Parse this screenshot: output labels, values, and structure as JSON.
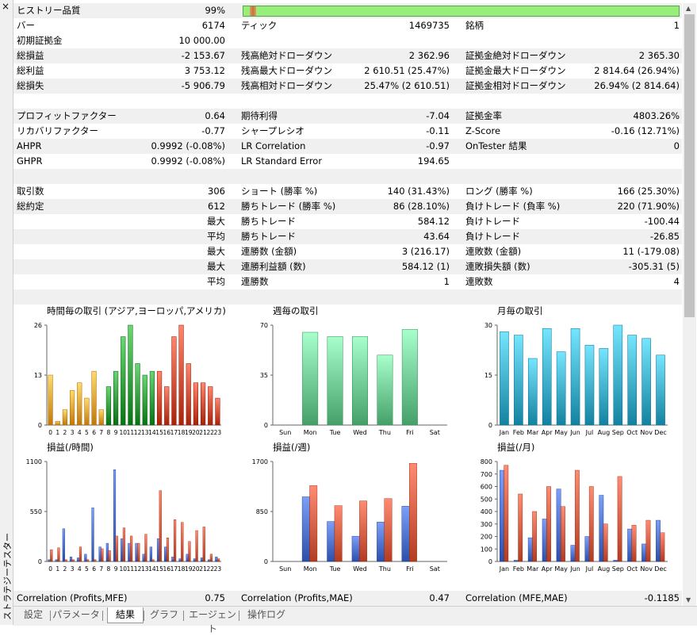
{
  "window": {
    "vertical_title": "ストラテジーテスター",
    "close_glyph": "×"
  },
  "quality": {
    "label": "ヒストリー品質",
    "value": "99%",
    "fraction": 0.99
  },
  "rows": [
    {
      "l1": "バー",
      "v1": "6174",
      "l2": "ティック",
      "v2": "1469735",
      "l3": "銘柄",
      "v3": "1",
      "shade": false
    },
    {
      "l1": "初期証拠金",
      "v1": "10 000.00",
      "l2": "",
      "v2": "",
      "l3": "",
      "v3": "",
      "shade": false
    },
    {
      "l1": "総損益",
      "v1": "-2 153.67",
      "l2": "残高絶対ドローダウン",
      "v2": "2 362.96",
      "l3": "証拠金絶対ドローダウン",
      "v3": "2 365.30",
      "shade": true
    },
    {
      "l1": "総利益",
      "v1": "3 753.12",
      "l2": "残高最大ドローダウン",
      "v2": "2 610.51 (25.47%)",
      "l3": "証拠金最大ドローダウン",
      "v3": "2 814.64 (26.94%)",
      "shade": false
    },
    {
      "l1": "総損失",
      "v1": "-5 906.79",
      "l2": "残高相対ドローダウン",
      "v2": "25.47% (2 610.51)",
      "l3": "証拠金相対ドローダウン",
      "v3": "26.94% (2 814.64)",
      "shade": true
    },
    {
      "l1": "",
      "v1": "",
      "l2": "",
      "v2": "",
      "l3": "",
      "v3": "",
      "shade": false
    },
    {
      "l1": "プロフィットファクター",
      "v1": "0.64",
      "l2": "期待利得",
      "v2": "-7.04",
      "l3": "証拠金率",
      "v3": "4803.26%",
      "shade": true
    },
    {
      "l1": "リカバリファクター",
      "v1": "-0.77",
      "l2": "シャープレシオ",
      "v2": "-0.11",
      "l3": "Z-Score",
      "v3": "-0.16 (12.71%)",
      "shade": false
    },
    {
      "l1": "AHPR",
      "v1": "0.9992 (-0.08%)",
      "l2": "LR Correlation",
      "v2": "-0.97",
      "l3": "OnTester 結果",
      "v3": "0",
      "shade": true
    },
    {
      "l1": "GHPR",
      "v1": "0.9992 (-0.08%)",
      "l2": "LR Standard Error",
      "v2": "194.65",
      "l3": "",
      "v3": "",
      "shade": false
    },
    {
      "l1": "",
      "v1": "",
      "l2": "",
      "v2": "",
      "l3": "",
      "v3": "",
      "shade": true
    },
    {
      "l1": "取引数",
      "v1": "306",
      "l2": "ショート (勝率 %)",
      "v2": "140 (31.43%)",
      "l3": "ロング (勝率 %)",
      "v3": "166 (25.30%)",
      "shade": false
    },
    {
      "l1": "総約定",
      "v1": "612",
      "l2": "勝ちトレード (勝率 %)",
      "v2": "86 (28.10%)",
      "l3": "負けトレード (負率 %)",
      "v3": "220 (71.90%)",
      "shade": true
    },
    {
      "l1": "",
      "v1": "最大",
      "l2": "勝ちトレード",
      "v2": "584.12",
      "l3": "負けトレード",
      "v3": "-100.44",
      "shade": false
    },
    {
      "l1": "",
      "v1": "平均",
      "l2": "勝ちトレード",
      "v2": "43.64",
      "l3": "負けトレード",
      "v3": "-26.85",
      "shade": true
    },
    {
      "l1": "",
      "v1": "最大",
      "l2": "連勝数 (金額)",
      "v2": "3 (216.17)",
      "l3": "連敗数 (金額)",
      "v3": "11 (-179.08)",
      "shade": false
    },
    {
      "l1": "",
      "v1": "最大",
      "l2": "連勝利益額 (数)",
      "v2": "584.12 (1)",
      "l3": "連敗損失額 (数)",
      "v3": "-305.31 (5)",
      "shade": true
    },
    {
      "l1": "",
      "v1": "平均",
      "l2": "連勝数",
      "v2": "1",
      "l3": "連敗数",
      "v3": "4",
      "shade": false
    },
    {
      "l1": "",
      "v1": "",
      "l2": "",
      "v2": "",
      "l3": "",
      "v3": "",
      "shade": true
    }
  ],
  "correlation_row": {
    "l1": "Correlation (Profits,MFE)",
    "v1": "0.75",
    "l2": "Correlation (Profits,MAE)",
    "v2": "0.47",
    "l3": "Correlation (MFE,MAE)",
    "v3": "-0.1185"
  },
  "tabs": [
    "設定",
    "パラメータ",
    "結果",
    "グラフ",
    "エージェント",
    "操作ログ"
  ],
  "active_tab": 2,
  "colors": {
    "asia": "#e8a030",
    "europe": "#2e9a3a",
    "america": "#d04a30",
    "week": "#6cc890",
    "month": "#3aaac8",
    "profit": "#d05a40",
    "loss": "#4a6ec8"
  },
  "chart_data": [
    {
      "id": "hourly-trades",
      "type": "bar",
      "title": "時間毎の取引 (アジア,ヨーロッパ,アメリカ)",
      "ylim": [
        0,
        26
      ],
      "yticks": [
        "0",
        "13",
        "26"
      ],
      "categories": [
        "0",
        "1",
        "2",
        "3",
        "4",
        "5",
        "6",
        "7",
        "8",
        "9",
        "10",
        "11",
        "12",
        "13",
        "14",
        "15",
        "16",
        "17",
        "18",
        "19",
        "20",
        "21",
        "22",
        "23"
      ],
      "values": [
        13,
        1,
        4,
        9,
        11,
        7,
        14,
        4,
        10,
        14,
        23,
        26,
        16,
        13,
        14,
        14,
        10,
        23,
        26,
        16,
        11,
        11,
        10,
        7
      ],
      "groups": [
        "asia",
        "asia",
        "asia",
        "asia",
        "asia",
        "asia",
        "asia",
        "asia",
        "europe",
        "europe",
        "europe",
        "europe",
        "europe",
        "europe",
        "europe",
        "america",
        "america",
        "america",
        "america",
        "america",
        "america",
        "america",
        "america",
        "america"
      ]
    },
    {
      "id": "weekly-trades",
      "type": "bar",
      "title": "週毎の取引",
      "ylim": [
        0,
        70
      ],
      "yticks": [
        "0",
        "35",
        "70"
      ],
      "categories": [
        "Sun",
        "Mon",
        "Tue",
        "Wed",
        "Thu",
        "Fri",
        "Sat"
      ],
      "values": [
        0,
        65,
        62,
        62,
        49,
        67,
        0
      ]
    },
    {
      "id": "monthly-trades",
      "type": "bar",
      "title": "月毎の取引",
      "ylim": [
        0,
        30
      ],
      "yticks": [
        "0",
        "15",
        "30"
      ],
      "categories": [
        "Jan",
        "Feb",
        "Mar",
        "Apr",
        "May",
        "Jun",
        "Jul",
        "Aug",
        "Sep",
        "Oct",
        "Nov",
        "Dec"
      ],
      "values": [
        28,
        27,
        20,
        29,
        22,
        29,
        24,
        23,
        30,
        27,
        26,
        21
      ]
    },
    {
      "id": "hourly-pnl",
      "type": "bar",
      "title": "損益(/時間)",
      "ylim": [
        0,
        1100
      ],
      "yticks": [
        "0",
        "550",
        "1100"
      ],
      "categories": [
        "0",
        "1",
        "2",
        "3",
        "4",
        "5",
        "6",
        "7",
        "8",
        "9",
        "10",
        "11",
        "12",
        "13",
        "14",
        "15",
        "16",
        "17",
        "18",
        "19",
        "20",
        "21",
        "22",
        "23"
      ],
      "series": [
        {
          "name": "loss",
          "values": [
            20,
            20,
            360,
            50,
            40,
            80,
            590,
            160,
            200,
            1010,
            250,
            200,
            200,
            80,
            160,
            250,
            160,
            50,
            30,
            80,
            30,
            40,
            20,
            50
          ]
        },
        {
          "name": "profit",
          "values": [
            130,
            150,
            20,
            20,
            160,
            20,
            20,
            140,
            120,
            280,
            370,
            280,
            200,
            300,
            20,
            780,
            260,
            460,
            430,
            220,
            340,
            380,
            80,
            30
          ]
        }
      ]
    },
    {
      "id": "weekly-pnl",
      "type": "bar",
      "title": "損益(/週)",
      "ylim": [
        0,
        1700
      ],
      "yticks": [
        "0",
        "850",
        "1700"
      ],
      "categories": [
        "Sun",
        "Mon",
        "Tue",
        "Wed",
        "Thu",
        "Fri",
        "Sat"
      ],
      "series": [
        {
          "name": "loss",
          "values": [
            0,
            1100,
            680,
            430,
            670,
            940,
            0
          ]
        },
        {
          "name": "profit",
          "values": [
            0,
            1290,
            950,
            1030,
            1070,
            1670,
            0
          ]
        }
      ]
    },
    {
      "id": "monthly-pnl",
      "type": "bar",
      "title": "損益(/月)",
      "ylim": [
        0,
        800
      ],
      "yticks": [
        "0",
        "100",
        "200",
        "300",
        "400",
        "500",
        "600",
        "700",
        "800"
      ],
      "categories": [
        "Jan",
        "Feb",
        "Mar",
        "Apr",
        "May",
        "Jun",
        "Jul",
        "Aug",
        "Sep",
        "Oct",
        "Nov",
        "Dec"
      ],
      "series": [
        {
          "name": "loss",
          "values": [
            730,
            10,
            190,
            340,
            580,
            130,
            200,
            530,
            10,
            260,
            140,
            330
          ]
        },
        {
          "name": "profit",
          "values": [
            770,
            540,
            400,
            600,
            440,
            730,
            600,
            300,
            680,
            290,
            330,
            230
          ]
        }
      ]
    }
  ]
}
